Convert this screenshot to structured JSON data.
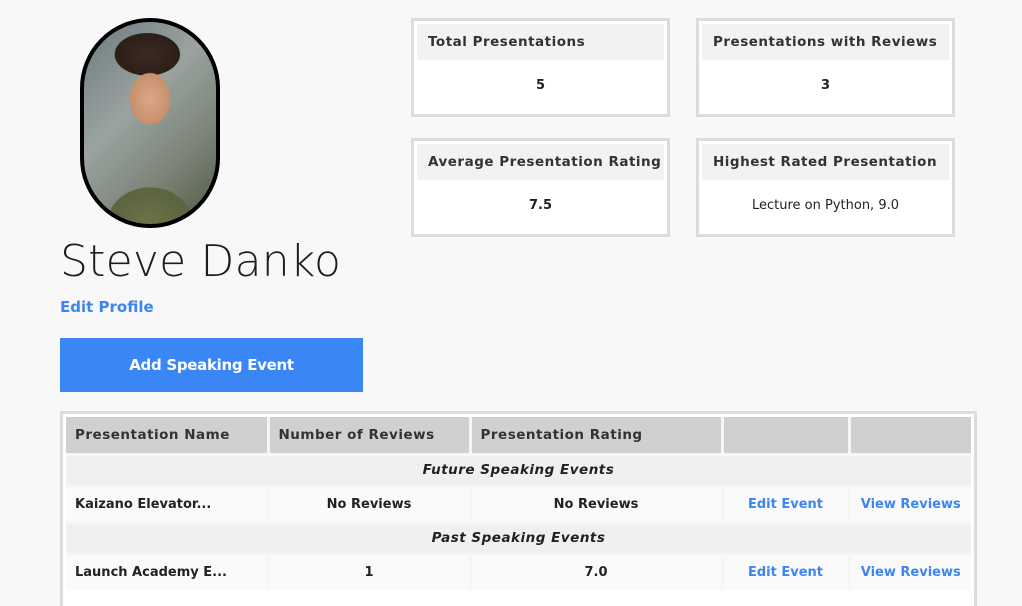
{
  "profile": {
    "name": "Steve Danko",
    "edit_label": "Edit Profile",
    "add_event_label": "Add Speaking Event"
  },
  "stats": [
    {
      "label": "Total Presentations",
      "value": "5"
    },
    {
      "label": "Presentations with Reviews",
      "value": "3"
    },
    {
      "label": "Average Presentation Rating",
      "value": "7.5"
    },
    {
      "label": "Highest Rated Presentation",
      "value": "Lecture on Python, 9.0"
    }
  ],
  "table": {
    "headers": [
      "Presentation Name",
      "Number of Reviews",
      "Presentation Rating",
      "",
      ""
    ],
    "future_section": "Future Speaking Events",
    "past_section": "Past Speaking Events",
    "future_rows": [
      {
        "name": "Kaizano Elevator...",
        "reviews": "No Reviews",
        "rating": "No Reviews",
        "edit": "Edit Event",
        "view": "View Reviews"
      }
    ],
    "past_rows": [
      {
        "name": "Launch Academy E...",
        "reviews": "1",
        "rating": "7.0",
        "edit": "Edit Event",
        "view": "View Reviews"
      }
    ]
  }
}
